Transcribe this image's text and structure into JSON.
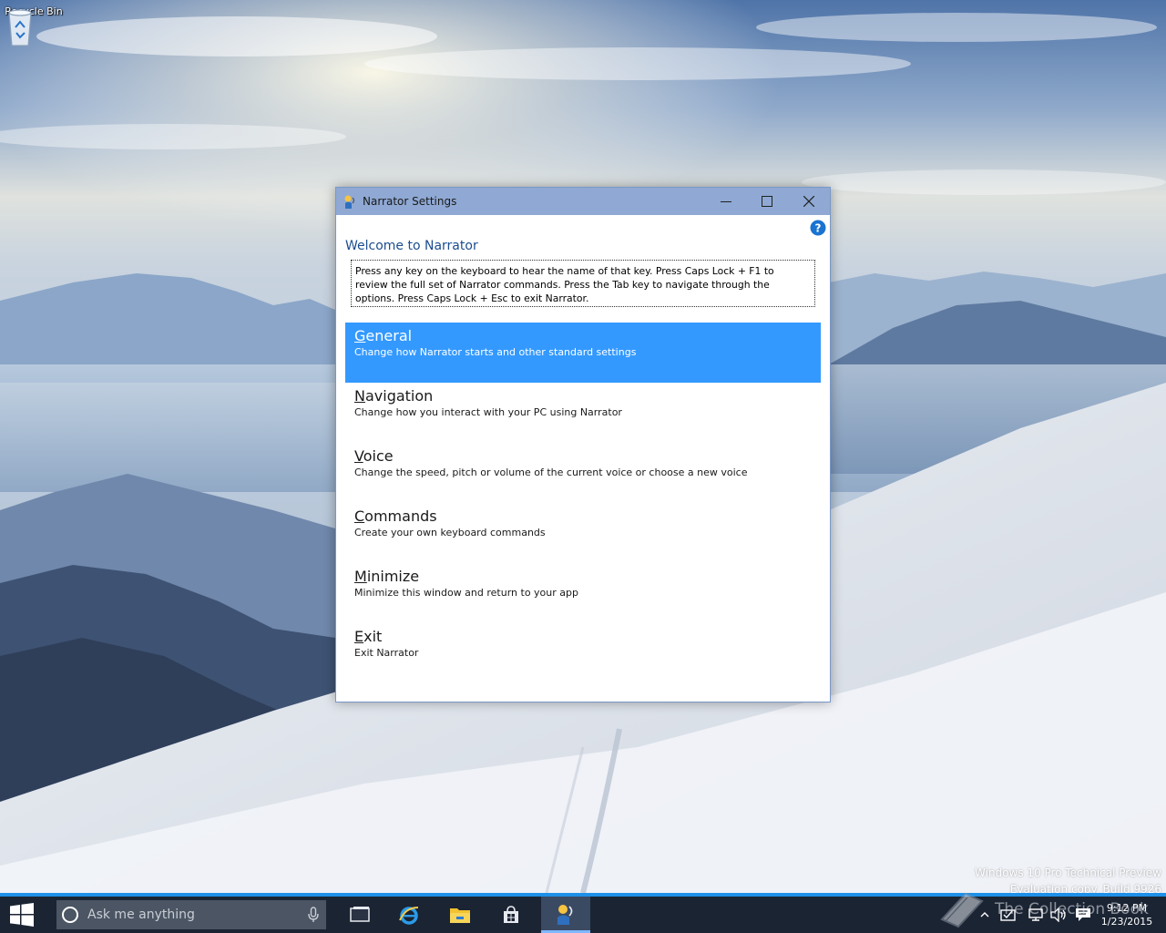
{
  "desktop": {
    "icons": [
      {
        "label": "Recycle Bin",
        "icon": "recycle-bin-icon"
      }
    ],
    "watermark": {
      "line1": "Windows 10 Pro Technical Preview",
      "line2": "Evaluation copy. Build 9926",
      "brand": "The Collection Book"
    }
  },
  "window": {
    "title": "Narrator Settings",
    "welcome": "Welcome to Narrator",
    "info": "Press any key on the keyboard to hear the name of that key.  Press Caps Lock + F1 to review the full set of Narrator commands.  Press the Tab key to navigate through the options.  Press Caps Lock + Esc to exit Narrator.",
    "menu": [
      {
        "accel": "G",
        "rest": "eneral",
        "desc": "Change how Narrator starts and other standard settings",
        "selected": true
      },
      {
        "accel": "N",
        "rest": "avigation",
        "desc": "Change how you interact with your PC using Narrator",
        "selected": false
      },
      {
        "accel": "V",
        "rest": "oice",
        "desc": "Change the speed, pitch or volume of the current voice or choose a new voice",
        "selected": false
      },
      {
        "accel": "C",
        "rest": "ommands",
        "desc": "Create your own keyboard commands",
        "selected": false
      },
      {
        "accel": "M",
        "rest": "inimize",
        "desc": "Minimize this window and return to your app",
        "selected": false
      },
      {
        "accel": "E",
        "rest": "xit",
        "desc": "Exit Narrator",
        "selected": false
      }
    ],
    "colors": {
      "titlebar": "#8fa9d4",
      "selected": "#3399ff",
      "heading": "#1b4d8f"
    }
  },
  "taskbar": {
    "search_placeholder": "Ask me anything",
    "apps": [
      "task-view-icon",
      "internet-explorer-icon",
      "file-explorer-icon",
      "store-icon",
      "narrator-icon"
    ],
    "clock": {
      "time": "9:12 PM",
      "date": "1/23/2015"
    },
    "accent": "#1e90e8"
  }
}
